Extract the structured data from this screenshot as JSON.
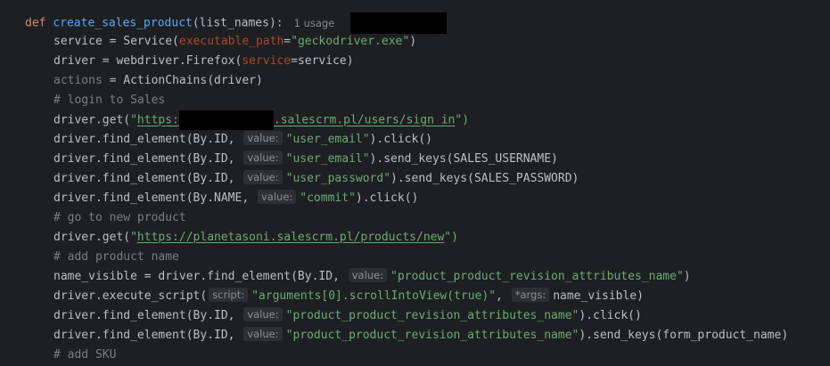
{
  "editor": {
    "line1": {
      "def_kw": "def",
      "fn_name": "create_sales_product",
      "params": "(list_names):",
      "usage": "1 usage"
    },
    "line2": {
      "lhs": "service = Service(",
      "param": "executable_path",
      "eq": "=",
      "value": "\"geckodriver.exe\"",
      "close": ")"
    },
    "line3": {
      "lhs": "driver = webdriver.Firefox(",
      "param": "service",
      "rest": "=service)"
    },
    "line4": {
      "lhs": "actions",
      "rest": " = ActionChains(driver)"
    },
    "line5": {
      "comment": "# login to Sales"
    },
    "line6": {
      "call": "driver.get(",
      "q": "\"",
      "url_start": "https:",
      "url_end": ".salescrm.pl/users/sign_in",
      "close": "\")"
    },
    "line7": {
      "call": "driver.find_element(By.ID, ",
      "hint": "value:",
      "value": "\"user_email\"",
      "rest": ").click()"
    },
    "line8": {
      "call": "driver.find_element(By.ID, ",
      "hint": "value:",
      "value": "\"user_email\"",
      "rest": ").send_keys(SALES_USERNAME)"
    },
    "line9": {
      "call": "driver.find_element(By.ID, ",
      "hint": "value:",
      "value": "\"user_password\"",
      "rest": ").send_keys(SALES_PASSWORD)"
    },
    "line10": {
      "call": "driver.find_element(By.NAME, ",
      "hint": "value:",
      "value": "\"commit\"",
      "rest": ").click()"
    },
    "line11": {
      "comment": "# go to new product"
    },
    "line12": {
      "call": "driver.get(",
      "q": "\"",
      "url": "https://planetasoni.salescrm.pl/products/new",
      "close": "\")"
    },
    "line13": {
      "comment": "# add product name"
    },
    "line14": {
      "lhs": "name_visible = driver.find_element(By.ID, ",
      "hint": "value:",
      "value": "\"product_product_revision_attributes_name\"",
      "rest": ")"
    },
    "line15": {
      "call": "driver.execute_script(",
      "hint1": "script:",
      "value": "\"arguments[0].scrollIntoView(true)\"",
      "comma": ", ",
      "hint2": "*args:",
      "rest": "name_visible)"
    },
    "line16": {
      "call": "driver.find_element(By.ID, ",
      "hint": "value:",
      "value": "\"product_product_revision_attributes_name\"",
      "rest": ").click()"
    },
    "line17": {
      "call": "driver.find_element(By.ID, ",
      "hint": "value:",
      "value": "\"product_product_revision_attributes_name\"",
      "rest": ").send_keys(form_product_name)"
    },
    "line18": {
      "comment": "# add SKU"
    }
  },
  "colors": {
    "background": "#1e1f22",
    "keyword": "#cf8e6d",
    "function": "#56a8f5",
    "string": "#6aab73",
    "named_arg": "#aa4926",
    "parameter": "#c77dbb",
    "comment": "#7a7e85",
    "text": "#bcbec4",
    "redaction": "#000000"
  }
}
